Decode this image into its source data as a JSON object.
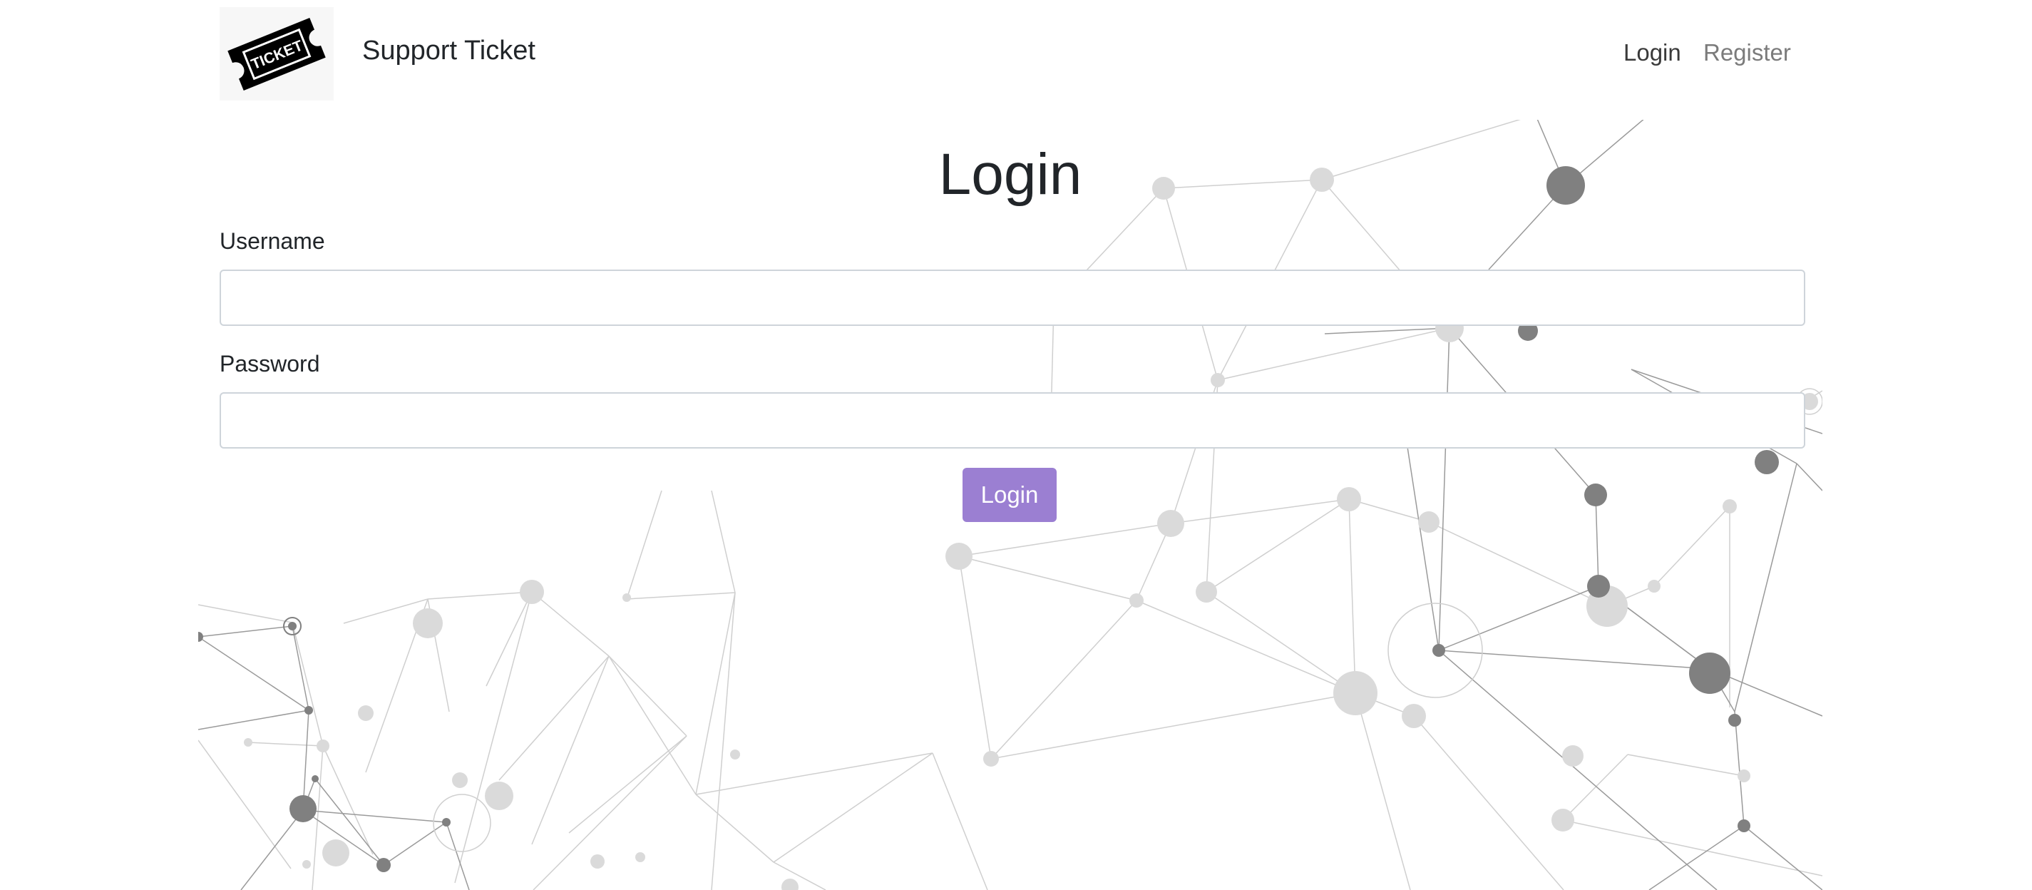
{
  "header": {
    "logo_icon": "ticket-icon",
    "logo_text": "TICKET",
    "brand": "Support Ticket",
    "nav": {
      "login": "Login",
      "register": "Register"
    }
  },
  "main": {
    "title": "Login",
    "username": {
      "label": "Username",
      "value": "",
      "placeholder": ""
    },
    "password": {
      "label": "Password",
      "value": "",
      "placeholder": ""
    },
    "submit_label": "Login"
  },
  "colors": {
    "primary_button": "#9b7fd2",
    "nav_active": "#3a3a3a",
    "nav_inactive": "#7b7b7b",
    "network_dark": "#808080",
    "network_light": "#d9d9d9"
  }
}
